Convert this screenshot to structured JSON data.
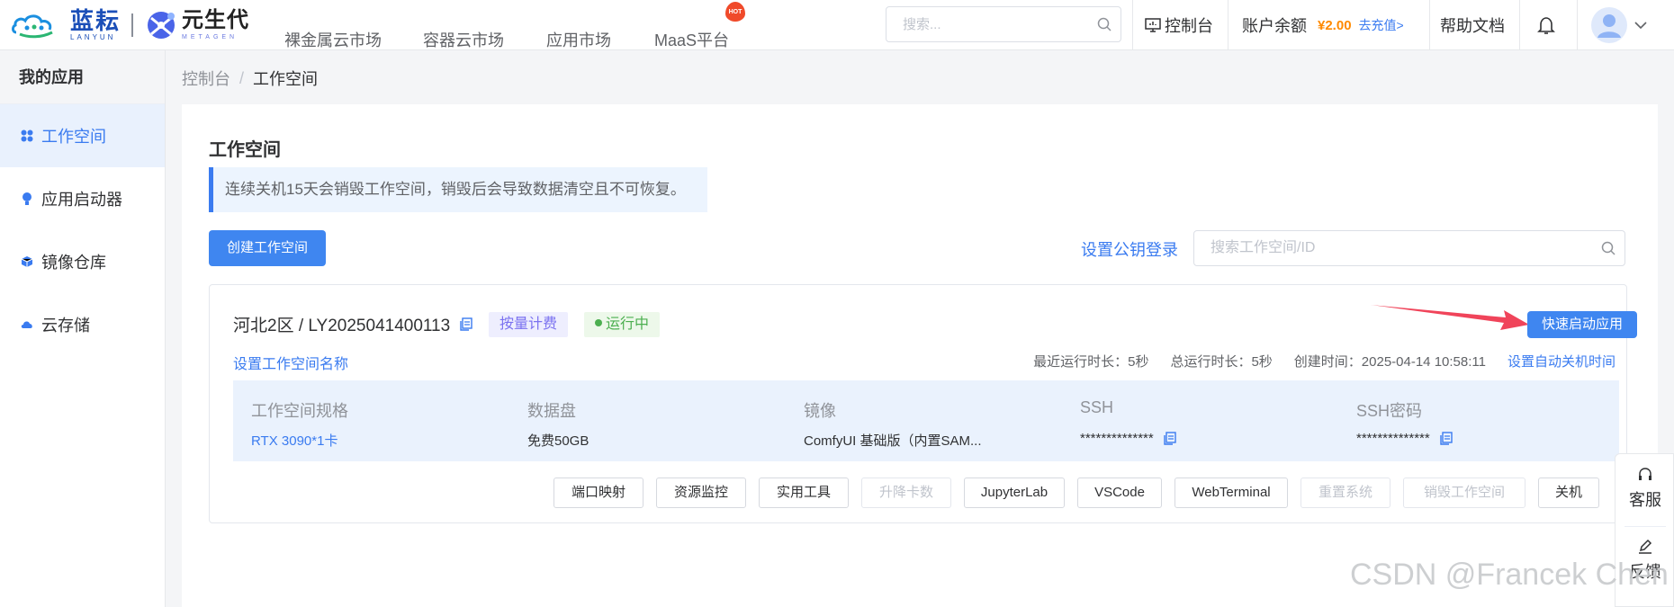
{
  "brand": {
    "logo_cn": "蓝耘",
    "logo_en": "LANYUN",
    "partner_cn": "元生代",
    "partner_en": "METAGEN"
  },
  "nav": {
    "items": [
      "裸金属云市场",
      "容器云市场",
      "应用市场",
      "MaaS平台"
    ],
    "hot_badge": "HOT",
    "search_placeholder": "搜索..."
  },
  "header": {
    "console": "控制台",
    "balance_label": "账户余额",
    "balance_amount": "¥2.00",
    "recharge": "去充值>",
    "help": "帮助文档"
  },
  "sidebar": {
    "title": "我的应用",
    "items": [
      {
        "label": "工作空间",
        "icon": "apps-icon",
        "active": true
      },
      {
        "label": "应用启动器",
        "icon": "bulb-icon",
        "active": false
      },
      {
        "label": "镜像仓库",
        "icon": "cube-icon",
        "active": false
      },
      {
        "label": "云存储",
        "icon": "cloud-icon",
        "active": false
      }
    ]
  },
  "breadcrumb": {
    "root": "控制台",
    "sep": "/",
    "current": "工作空间"
  },
  "page": {
    "title": "工作空间",
    "notice": "连续关机15天会销毁工作空间，销毁后会导致数据清空且不可恢复。",
    "create_button": "创建工作空间",
    "key_login": "设置公钥登录",
    "search_placeholder": "搜索工作空间/ID"
  },
  "workspace": {
    "name": "河北2区 / LY2025041400113",
    "billing_tag": "按量计费",
    "status": "运行中",
    "quick_start": "快速启动应用",
    "rename": "设置工作空间名称",
    "recent_runtime": "最近运行时长：5秒",
    "total_runtime": "总运行时长：5秒",
    "created": "创建时间：2025-04-14 10:58:11",
    "auto_shutdown": "设置自动关机时间",
    "specs": [
      {
        "label": "工作空间规格",
        "value": "RTX 3090*1卡"
      },
      {
        "label": "数据盘",
        "value": "免费50GB"
      },
      {
        "label": "镜像",
        "value": "ComfyUI 基础版（内置SAM..."
      },
      {
        "label": "SSH",
        "value": "**************"
      },
      {
        "label": "SSH密码",
        "value": "**************"
      }
    ],
    "actions": [
      {
        "label": "端口映射",
        "disabled": false
      },
      {
        "label": "资源监控",
        "disabled": false
      },
      {
        "label": "实用工具",
        "disabled": false
      },
      {
        "label": "升降卡数",
        "disabled": true
      },
      {
        "label": "JupyterLab",
        "disabled": false
      },
      {
        "label": "VSCode",
        "disabled": false
      },
      {
        "label": "WebTerminal",
        "disabled": false
      },
      {
        "label": "重置系统",
        "disabled": true
      },
      {
        "label": "销毁工作空间",
        "disabled": true
      },
      {
        "label": "关机",
        "disabled": false
      }
    ]
  },
  "float": {
    "service": "客服",
    "feedback": "反馈"
  },
  "watermark": "CSDN @Francek Chen",
  "colors": {
    "primary": "#3f86f0",
    "link": "#3a7bf0",
    "balance": "#ff8a00",
    "running": "#4caf50",
    "billing": "#7b72f0",
    "arrow": "#f0445a"
  }
}
